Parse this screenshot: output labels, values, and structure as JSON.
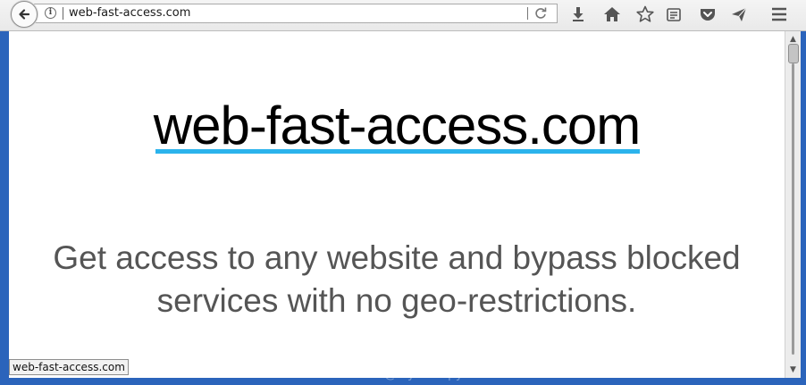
{
  "browser": {
    "url": "web-fast-access.com",
    "info_glyph": "i",
    "icons": [
      "back-arrow-icon",
      "info-icon",
      "reload-icon",
      "download-icon",
      "home-icon",
      "bookmark-star-icon",
      "reader-view-icon",
      "pocket-icon",
      "send-icon",
      "menu-icon"
    ]
  },
  "page": {
    "title": "web-fast-access.com",
    "tagline_line1": "Get access to any website and bypass blocked",
    "tagline_line2": "services with no geo-restrictions.",
    "accent_color": "#2bb3ec"
  },
  "status_bar": {
    "text": "web-fast-access.com"
  },
  "watermark": {
    "text": "web-fast-access.com@MyAntiSpyware"
  },
  "scrollbar": {
    "up_glyph": "▲",
    "down_glyph": "▼"
  }
}
